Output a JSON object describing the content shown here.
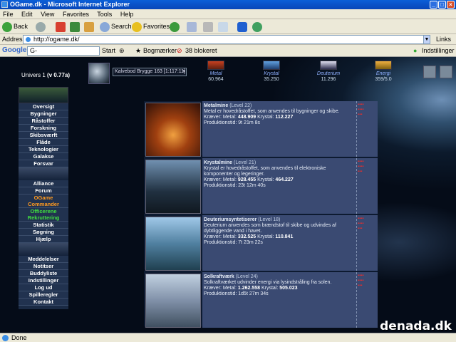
{
  "window": {
    "title": "OGame.dk - Microsoft Internet Explorer"
  },
  "menu": [
    "File",
    "Edit",
    "View",
    "Favorites",
    "Tools",
    "Help"
  ],
  "toolbar": {
    "back": "Back",
    "search": "Search",
    "favorites": "Favorites"
  },
  "address": {
    "label": "Address",
    "url": "http://ogame.dk/",
    "links": "Links"
  },
  "google": {
    "logo": "Google",
    "field": "G-",
    "start": "Start",
    "bookmarks": "Bogmærker",
    "blocked": "38 blokeret",
    "settings": "Indstillinger"
  },
  "game": {
    "universe": "Univers 1",
    "version": "(v 0.77a)",
    "planet_select": "Kalvebod Brygge 163 [1:117:11]",
    "resources": [
      {
        "name": "Metal",
        "value": "60.964"
      },
      {
        "name": "Krystal",
        "value": "35.250"
      },
      {
        "name": "Deuterium",
        "value": "11.296"
      },
      {
        "name": "Energi",
        "value": "359/5.0"
      }
    ],
    "menu_items": [
      {
        "label": "Oversigt",
        "style": "normal"
      },
      {
        "label": "Bygninger",
        "style": "normal"
      },
      {
        "label": "Råstoffer",
        "style": "normal"
      },
      {
        "label": "Forskning",
        "style": "normal"
      },
      {
        "label": "Skibsværft",
        "style": "normal"
      },
      {
        "label": "Flåde",
        "style": "normal"
      },
      {
        "label": "Teknologier",
        "style": "normal"
      },
      {
        "label": "Galakse",
        "style": "normal"
      },
      {
        "label": "Forsvar",
        "style": "normal"
      }
    ],
    "menu_items_2": [
      {
        "label": "Alliance",
        "style": "normal"
      },
      {
        "label": "Forum",
        "style": "normal"
      },
      {
        "label": "OGame Commander",
        "style": "orange"
      },
      {
        "label": "Officerene Rekruttering",
        "style": "green"
      },
      {
        "label": "Statistik",
        "style": "normal"
      },
      {
        "label": "Søgning",
        "style": "normal"
      },
      {
        "label": "Hjælp",
        "style": "normal"
      }
    ],
    "menu_items_3": [
      {
        "label": "Meddelelser",
        "style": "normal"
      },
      {
        "label": "Notitser",
        "style": "normal"
      },
      {
        "label": "Buddyliste",
        "style": "normal"
      },
      {
        "label": "Indstillinger",
        "style": "normal"
      },
      {
        "label": "Log ud",
        "style": "normal"
      },
      {
        "label": "Spilleregler",
        "style": "normal"
      },
      {
        "label": "Kontakt",
        "style": "normal"
      }
    ],
    "buildings": [
      {
        "name": "Metalmine",
        "level": "(Level 22)",
        "desc": "Metal er hovedråstoffet, som anvendes til bygninger og skibe.",
        "metal": "448.909",
        "crystal": "112.227",
        "time": "9t 21m 8s"
      },
      {
        "name": "Krystalmine",
        "level": "(Level 21)",
        "desc": "Krystal er hovedråstoffet, som anvendes til elektroniske komponenter og legeringer.",
        "metal": "928.455",
        "crystal": "464.227",
        "time": "23t 12m 40s"
      },
      {
        "name": "Deuteriumsyntetiserer",
        "level": "(Level 18)",
        "desc": "Deuterium anvendes som brændstof til skibe og udvindes af dybtliggende vand i havet.",
        "metal": "332.525",
        "crystal": "110.841",
        "time": "7t 23m 22s"
      },
      {
        "name": "Solkraftværk",
        "level": "(Level 24)",
        "desc": "Solkraftværket udvinder energi via lysindstråling fra solen.",
        "metal": "1.262.558",
        "crystal": "505.023",
        "time": "1d5t 27m 34s"
      }
    ],
    "labels": {
      "requires": "Kræver: Metal:",
      "crystal": "Krystal:",
      "production": "Produktionstid:"
    }
  },
  "status": {
    "text": "Done"
  },
  "watermark": "denada.dk"
}
